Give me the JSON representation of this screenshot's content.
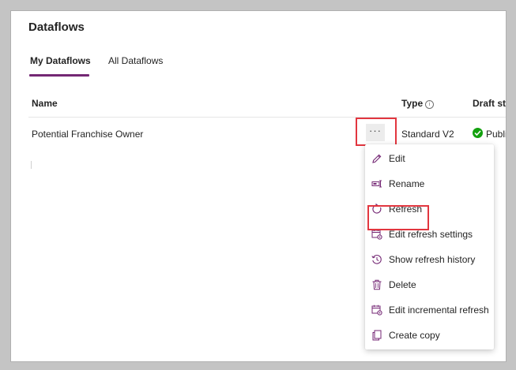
{
  "page": {
    "title": "Dataflows",
    "tabs": [
      {
        "label": "My Dataflows",
        "active": true
      },
      {
        "label": "All Dataflows",
        "active": false
      }
    ],
    "accent_color": "#742774",
    "highlight_color": "#e2363f"
  },
  "table": {
    "headers": {
      "name": "Name",
      "type": "Type",
      "draft_status": "Draft sta"
    },
    "rows": [
      {
        "name": "Potential Franchise Owner",
        "more_label": "···",
        "type": "Standard V2",
        "status_icon": "check-circle-icon",
        "status_text": "Publi"
      }
    ]
  },
  "context_menu": {
    "items": [
      {
        "label": "Edit",
        "icon": "pencil-icon"
      },
      {
        "label": "Rename",
        "icon": "rename-icon"
      },
      {
        "label": "Refresh",
        "icon": "refresh-icon"
      },
      {
        "label": "Edit refresh settings",
        "icon": "calendar-settings-icon"
      },
      {
        "label": "Show refresh history",
        "icon": "history-icon"
      },
      {
        "label": "Delete",
        "icon": "trash-icon"
      },
      {
        "label": "Edit incremental refresh",
        "icon": "calendar-settings-icon"
      },
      {
        "label": "Create copy",
        "icon": "copy-icon"
      }
    ]
  }
}
